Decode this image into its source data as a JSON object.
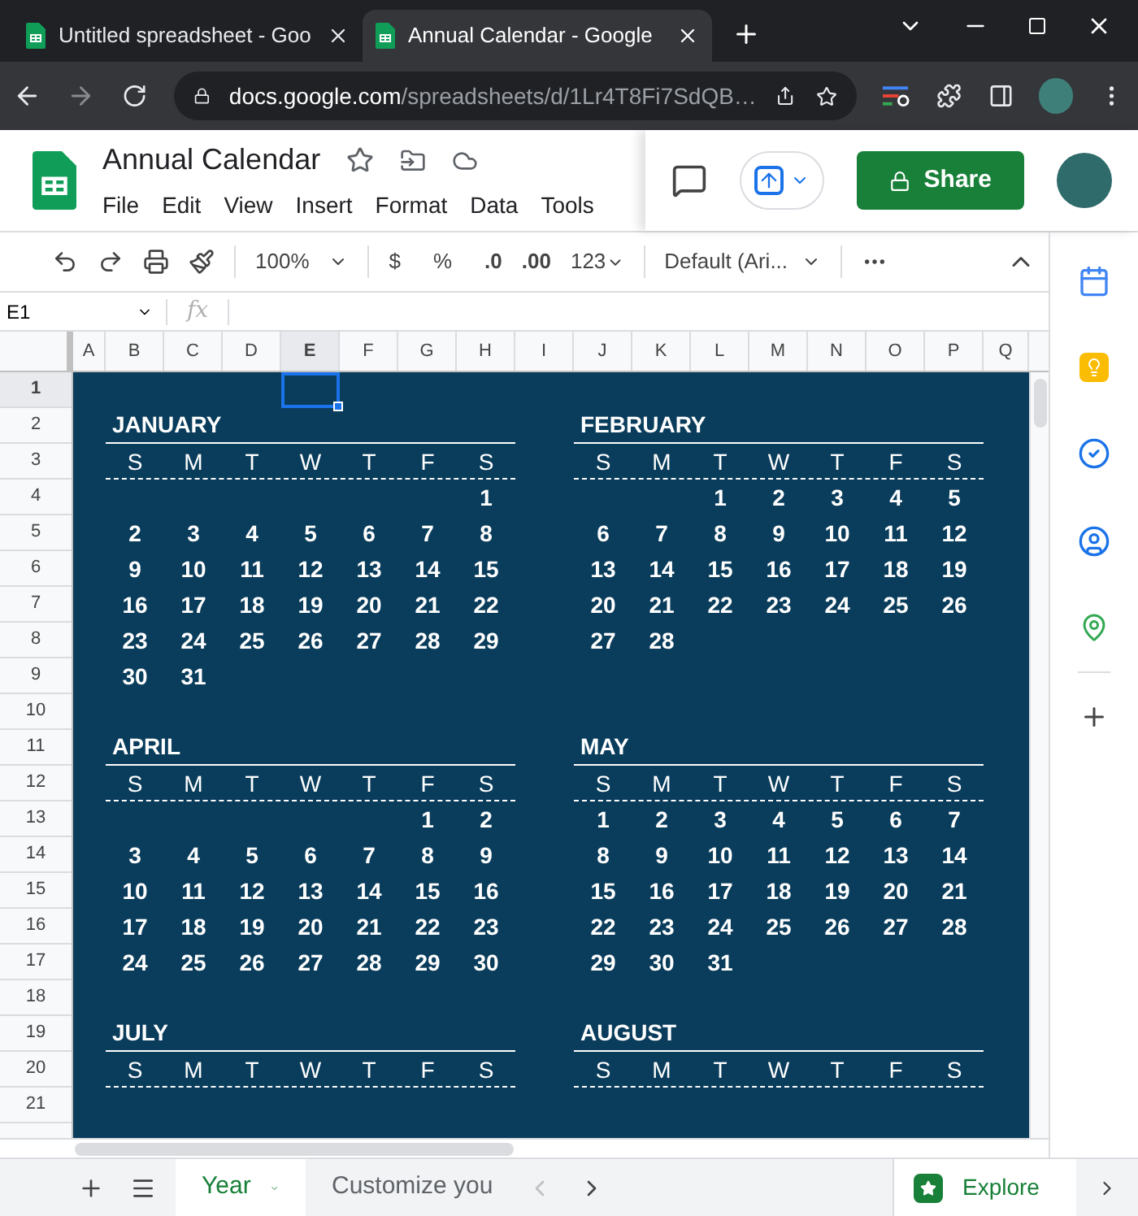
{
  "browser": {
    "tabs": [
      {
        "title": "Untitled spreadsheet - Goo",
        "selected": false
      },
      {
        "title": "Annual Calendar - Google",
        "selected": true
      }
    ],
    "url": {
      "host": "docs.google.com",
      "path": "/spreadsheets/d/1Lr4T8Fi7SdQB…"
    }
  },
  "doc": {
    "title": "Annual Calendar",
    "menu": [
      "File",
      "Edit",
      "View",
      "Insert",
      "Format",
      "Data",
      "Tools"
    ],
    "share": "Share"
  },
  "toolbar": {
    "zoom": "100%",
    "currency": "$",
    "percent": "%",
    "decrease_decimal": ".0",
    "increase_decimal": ".00",
    "number_format": "123",
    "font": "Default (Ari..."
  },
  "formula_bar": {
    "cell": "E1",
    "fx": "fx"
  },
  "columns": [
    {
      "label": "A",
      "selected": false
    },
    {
      "label": "B",
      "selected": false
    },
    {
      "label": "C",
      "selected": false
    },
    {
      "label": "D",
      "selected": false
    },
    {
      "label": "E",
      "selected": true
    },
    {
      "label": "F",
      "selected": false
    },
    {
      "label": "G",
      "selected": false
    },
    {
      "label": "H",
      "selected": false
    },
    {
      "label": "I",
      "selected": false
    },
    {
      "label": "J",
      "selected": false
    },
    {
      "label": "K",
      "selected": false
    },
    {
      "label": "L",
      "selected": false
    },
    {
      "label": "M",
      "selected": false
    },
    {
      "label": "N",
      "selected": false
    },
    {
      "label": "O",
      "selected": false
    },
    {
      "label": "P",
      "selected": false
    },
    {
      "label": "Q",
      "selected": false
    }
  ],
  "rows": [
    {
      "label": "1",
      "selected": true
    },
    {
      "label": "2",
      "selected": false
    },
    {
      "label": "3",
      "selected": false
    },
    {
      "label": "4",
      "selected": false
    },
    {
      "label": "5",
      "selected": false
    },
    {
      "label": "6",
      "selected": false
    },
    {
      "label": "7",
      "selected": false
    },
    {
      "label": "8",
      "selected": false
    },
    {
      "label": "9",
      "selected": false
    },
    {
      "label": "10",
      "selected": false
    },
    {
      "label": "11",
      "selected": false
    },
    {
      "label": "12",
      "selected": false
    },
    {
      "label": "13",
      "selected": false
    },
    {
      "label": "14",
      "selected": false
    },
    {
      "label": "15",
      "selected": false
    },
    {
      "label": "16",
      "selected": false
    },
    {
      "label": "17",
      "selected": false
    },
    {
      "label": "18",
      "selected": false
    },
    {
      "label": "19",
      "selected": false
    },
    {
      "label": "20",
      "selected": false
    },
    {
      "label": "21",
      "selected": false
    }
  ],
  "months": [
    {
      "name": "JANUARY",
      "weekdays": [
        "S",
        "M",
        "T",
        "W",
        "T",
        "F",
        "S"
      ],
      "weeks": [
        {
          "kind": "lead",
          "days": [
            "1"
          ]
        },
        {
          "kind": "full",
          "days": [
            "2",
            "3",
            "4",
            "5",
            "6",
            "7",
            "8"
          ]
        },
        {
          "kind": "full",
          "days": [
            "9",
            "10",
            "11",
            "12",
            "13",
            "14",
            "15"
          ]
        },
        {
          "kind": "full",
          "days": [
            "16",
            "17",
            "18",
            "19",
            "20",
            "21",
            "22"
          ]
        },
        {
          "kind": "full",
          "days": [
            "23",
            "24",
            "25",
            "26",
            "27",
            "28",
            "29"
          ]
        },
        {
          "kind": "full",
          "days": [
            "30",
            "31"
          ]
        }
      ]
    },
    {
      "name": "FEBRUARY",
      "weekdays": [
        "S",
        "M",
        "T",
        "W",
        "T",
        "F",
        "S"
      ],
      "weeks": [
        {
          "kind": "lead",
          "days": [
            "1",
            "2",
            "3",
            "4",
            "5"
          ]
        },
        {
          "kind": "full",
          "days": [
            "6",
            "7",
            "8",
            "9",
            "10",
            "11",
            "12"
          ]
        },
        {
          "kind": "full",
          "days": [
            "13",
            "14",
            "15",
            "16",
            "17",
            "18",
            "19"
          ]
        },
        {
          "kind": "full",
          "days": [
            "20",
            "21",
            "22",
            "23",
            "24",
            "25",
            "26"
          ]
        },
        {
          "kind": "full",
          "days": [
            "27",
            "28"
          ]
        }
      ]
    },
    {
      "name": "APRIL",
      "weekdays": [
        "S",
        "M",
        "T",
        "W",
        "T",
        "F",
        "S"
      ],
      "weeks": [
        {
          "kind": "lead",
          "days": [
            "1",
            "2"
          ]
        },
        {
          "kind": "full",
          "days": [
            "3",
            "4",
            "5",
            "6",
            "7",
            "8",
            "9"
          ]
        },
        {
          "kind": "full",
          "days": [
            "10",
            "11",
            "12",
            "13",
            "14",
            "15",
            "16"
          ]
        },
        {
          "kind": "full",
          "days": [
            "17",
            "18",
            "19",
            "20",
            "21",
            "22",
            "23"
          ]
        },
        {
          "kind": "full",
          "days": [
            "24",
            "25",
            "26",
            "27",
            "28",
            "29",
            "30"
          ]
        }
      ]
    },
    {
      "name": "MAY",
      "weekdays": [
        "S",
        "M",
        "T",
        "W",
        "T",
        "F",
        "S"
      ],
      "weeks": [
        {
          "kind": "full",
          "days": [
            "1",
            "2",
            "3",
            "4",
            "5",
            "6",
            "7"
          ]
        },
        {
          "kind": "full",
          "days": [
            "8",
            "9",
            "10",
            "11",
            "12",
            "13",
            "14"
          ]
        },
        {
          "kind": "full",
          "days": [
            "15",
            "16",
            "17",
            "18",
            "19",
            "20",
            "21"
          ]
        },
        {
          "kind": "full",
          "days": [
            "22",
            "23",
            "24",
            "25",
            "26",
            "27",
            "28"
          ]
        },
        {
          "kind": "full",
          "days": [
            "29",
            "30",
            "31"
          ]
        }
      ]
    },
    {
      "name": "JULY",
      "weekdays": [
        "S",
        "M",
        "T",
        "W",
        "T",
        "F",
        "S"
      ]
    },
    {
      "name": "AUGUST",
      "weekdays": [
        "S",
        "M",
        "T",
        "W",
        "T",
        "F",
        "S"
      ]
    }
  ],
  "sheet_tabs": [
    {
      "label": "Year",
      "selected": true
    },
    {
      "label": "Customize you",
      "selected": false
    }
  ],
  "explore": "Explore"
}
